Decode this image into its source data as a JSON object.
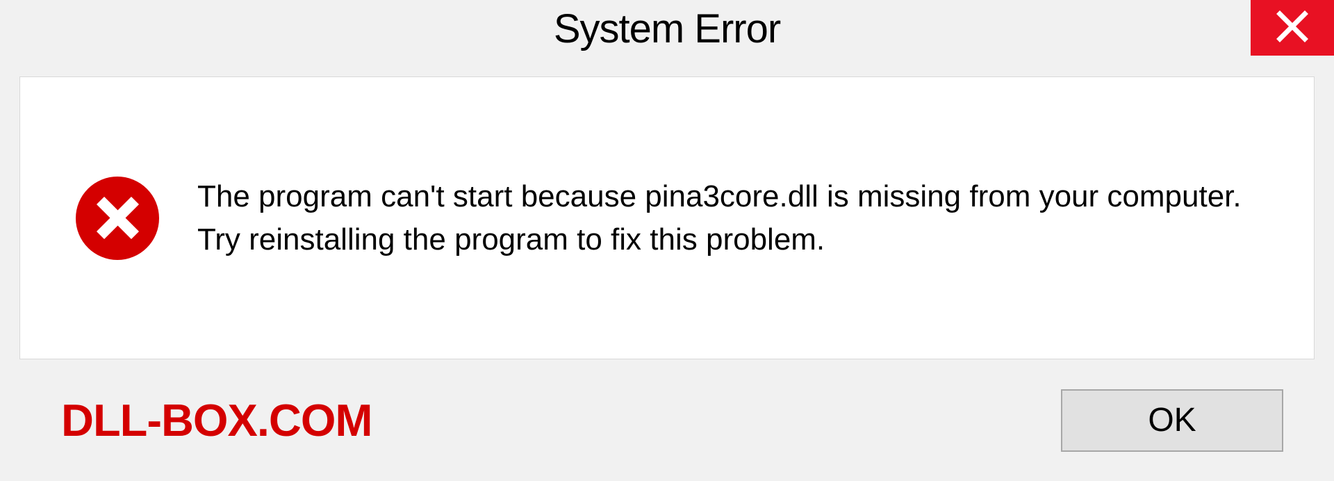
{
  "titlebar": {
    "title": "System Error"
  },
  "message": {
    "text": "The program can't start because pina3core.dll is missing from your computer. Try reinstalling the program to fix this problem."
  },
  "footer": {
    "brand": "DLL-BOX.COM",
    "ok_label": "OK"
  }
}
